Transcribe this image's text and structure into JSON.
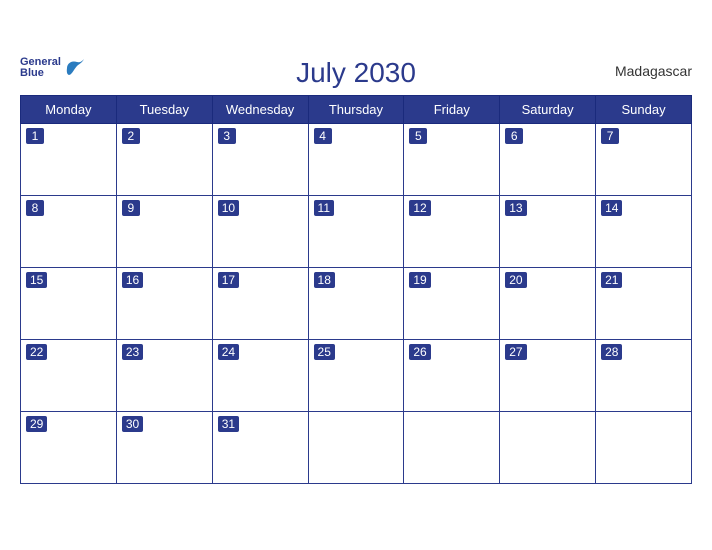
{
  "header": {
    "title": "July 2030",
    "country": "Madagascar",
    "logo_general": "General",
    "logo_blue": "Blue"
  },
  "weekdays": [
    "Monday",
    "Tuesday",
    "Wednesday",
    "Thursday",
    "Friday",
    "Saturday",
    "Sunday"
  ],
  "weeks": [
    [
      1,
      2,
      3,
      4,
      5,
      6,
      7
    ],
    [
      8,
      9,
      10,
      11,
      12,
      13,
      14
    ],
    [
      15,
      16,
      17,
      18,
      19,
      20,
      21
    ],
    [
      22,
      23,
      24,
      25,
      26,
      27,
      28
    ],
    [
      29,
      30,
      31,
      null,
      null,
      null,
      null
    ]
  ]
}
